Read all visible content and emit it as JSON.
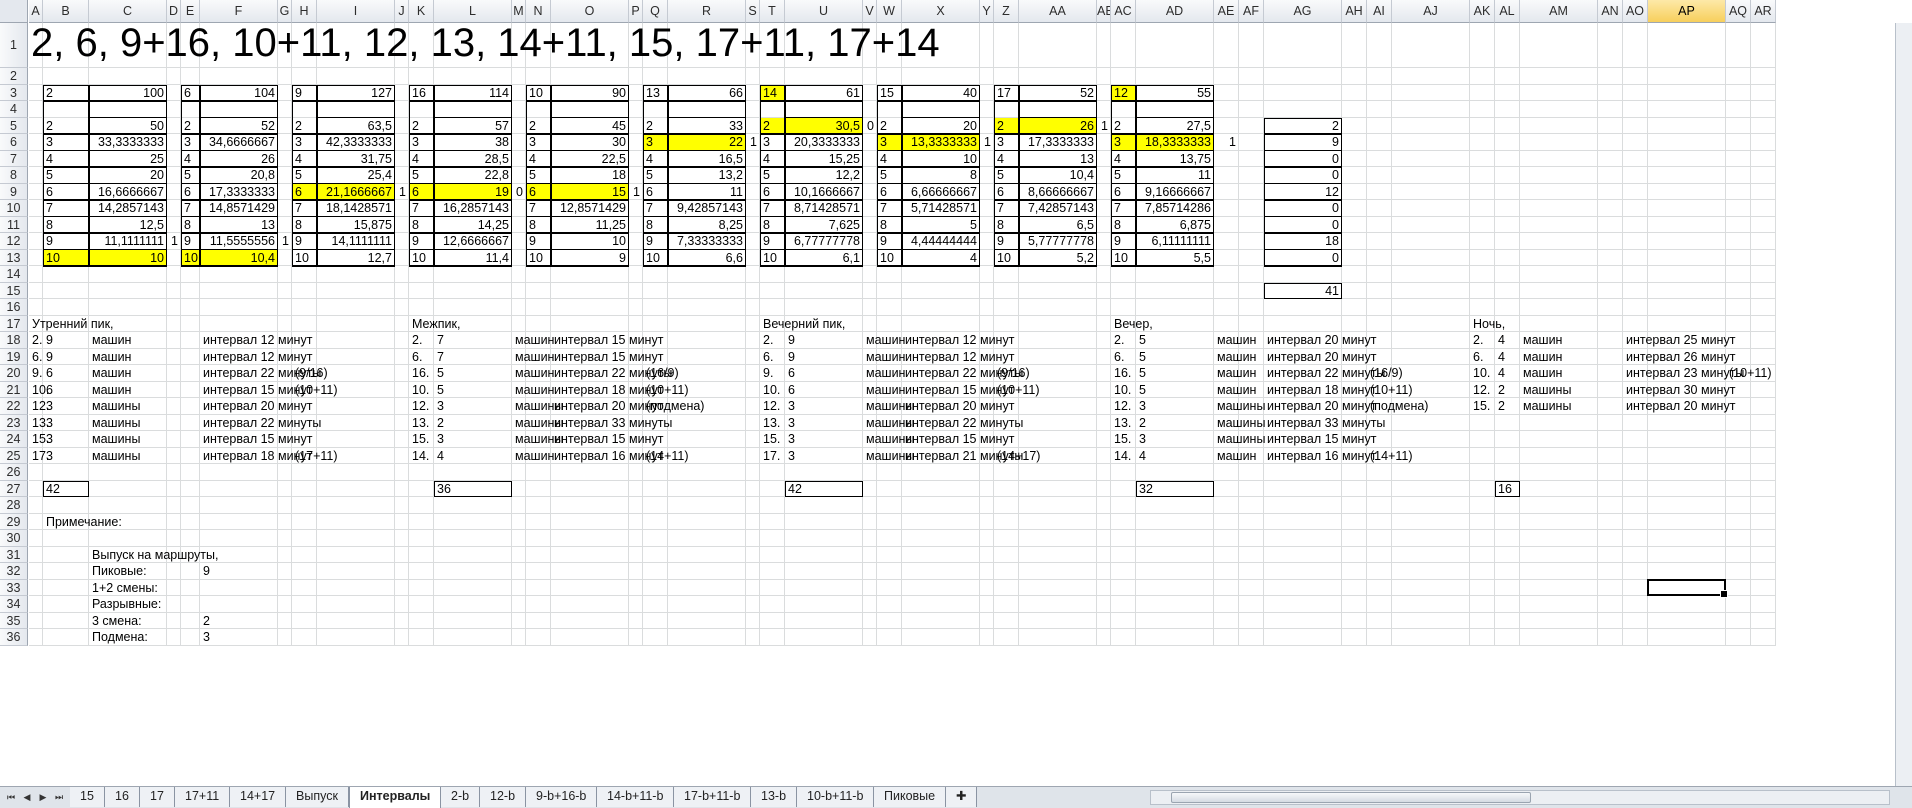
{
  "columns": [
    "A",
    "B",
    "C",
    "D",
    "E",
    "F",
    "G",
    "H",
    "I",
    "J",
    "K",
    "L",
    "M",
    "N",
    "O",
    "P",
    "Q",
    "R",
    "S",
    "T",
    "U",
    "V",
    "W",
    "X",
    "Y",
    "Z",
    "AA",
    "AB",
    "AC",
    "AD",
    "AE",
    "AF",
    "AG",
    "AH",
    "AI",
    "AJ",
    "AK",
    "AL",
    "AM",
    "AN",
    "AO",
    "AP",
    "AQ",
    "AR"
  ],
  "selected_column": "AP",
  "rows": [
    "1",
    "2",
    "3",
    "4",
    "5",
    "6",
    "7",
    "8",
    "9",
    "10",
    "11",
    "12",
    "13",
    "14",
    "15",
    "16",
    "17",
    "18",
    "19",
    "20",
    "21",
    "22",
    "23",
    "24",
    "25",
    "26",
    "27",
    "28",
    "29",
    "30",
    "31",
    "32",
    "33",
    "34",
    "35",
    "36"
  ],
  "title": "2, 6, 9+16, 10+11, 12, 13, 14+11, 15, 17+11, 17+14",
  "blocks": [
    {
      "header": [
        "2",
        "100"
      ],
      "rows": [
        [
          "2",
          "50"
        ],
        [
          "3",
          "33,3333333"
        ],
        [
          "4",
          "25"
        ],
        [
          "5",
          "20"
        ],
        [
          "6",
          "16,6666667"
        ],
        [
          "7",
          "14,2857143"
        ],
        [
          "8",
          "12,5"
        ],
        [
          "9",
          "11,1111111"
        ],
        [
          "10",
          "10"
        ]
      ],
      "side": [
        "",
        "",
        "",
        "",
        "",
        "",
        "",
        "1",
        ""
      ]
    },
    {
      "header": [
        "6",
        "104"
      ],
      "rows": [
        [
          "2",
          "52"
        ],
        [
          "3",
          "34,6666667"
        ],
        [
          "4",
          "26"
        ],
        [
          "5",
          "20,8"
        ],
        [
          "6",
          "17,3333333"
        ],
        [
          "7",
          "14,8571429"
        ],
        [
          "8",
          "13"
        ],
        [
          "9",
          "11,5555556"
        ],
        [
          "10",
          "10,4"
        ]
      ],
      "side": [
        "",
        "",
        "",
        "",
        "",
        "",
        "",
        "1",
        ""
      ]
    },
    {
      "header": [
        "9",
        "127"
      ],
      "rows": [
        [
          "2",
          "63,5"
        ],
        [
          "3",
          "42,3333333"
        ],
        [
          "4",
          "31,75"
        ],
        [
          "5",
          "25,4"
        ],
        [
          "6",
          "21,1666667"
        ],
        [
          "7",
          "18,1428571"
        ],
        [
          "8",
          "15,875"
        ],
        [
          "9",
          "14,1111111"
        ],
        [
          "10",
          "12,7"
        ]
      ],
      "side": [
        "",
        "",
        "",
        "",
        "1",
        "",
        "",
        "",
        ""
      ]
    },
    {
      "header": [
        "16",
        "114"
      ],
      "rows": [
        [
          "2",
          "57"
        ],
        [
          "3",
          "38"
        ],
        [
          "4",
          "28,5"
        ],
        [
          "5",
          "22,8"
        ],
        [
          "6",
          "19"
        ],
        [
          "7",
          "16,2857143"
        ],
        [
          "8",
          "14,25"
        ],
        [
          "9",
          "12,6666667"
        ],
        [
          "10",
          "11,4"
        ]
      ],
      "side": [
        "",
        "",
        "",
        "",
        "0",
        "",
        "",
        "",
        ""
      ]
    },
    {
      "header": [
        "10",
        "90"
      ],
      "rows": [
        [
          "2",
          "45"
        ],
        [
          "3",
          "30"
        ],
        [
          "4",
          "22,5"
        ],
        [
          "5",
          "18"
        ],
        [
          "6",
          "15"
        ],
        [
          "7",
          "12,8571429"
        ],
        [
          "8",
          "11,25"
        ],
        [
          "9",
          "10"
        ],
        [
          "10",
          "9"
        ]
      ],
      "side": [
        "",
        "",
        "",
        "",
        "1",
        "",
        "",
        "",
        ""
      ]
    },
    {
      "header": [
        "13",
        "66"
      ],
      "rows": [
        [
          "2",
          "33"
        ],
        [
          "3",
          "22"
        ],
        [
          "4",
          "16,5"
        ],
        [
          "5",
          "13,2"
        ],
        [
          "6",
          "11"
        ],
        [
          "7",
          "9,42857143"
        ],
        [
          "8",
          "8,25"
        ],
        [
          "9",
          "7,33333333"
        ],
        [
          "10",
          "6,6"
        ]
      ],
      "side": [
        "",
        "1",
        "",
        "",
        "",
        "",
        "",
        "",
        ""
      ]
    },
    {
      "header": [
        "14",
        "61"
      ],
      "rows": [
        [
          "2",
          "30,5"
        ],
        [
          "3",
          "20,3333333"
        ],
        [
          "4",
          "15,25"
        ],
        [
          "5",
          "12,2"
        ],
        [
          "6",
          "10,1666667"
        ],
        [
          "7",
          "8,71428571"
        ],
        [
          "8",
          "7,625"
        ],
        [
          "9",
          "6,77777778"
        ],
        [
          "10",
          "6,1"
        ]
      ],
      "side": [
        "0",
        "",
        "",
        "",
        "",
        "",
        "",
        "",
        ""
      ]
    },
    {
      "header": [
        "15",
        "40"
      ],
      "rows": [
        [
          "2",
          "20"
        ],
        [
          "3",
          "13,3333333"
        ],
        [
          "4",
          "10"
        ],
        [
          "5",
          "8"
        ],
        [
          "6",
          "6,66666667"
        ],
        [
          "7",
          "5,71428571"
        ],
        [
          "8",
          "5"
        ],
        [
          "9",
          "4,44444444"
        ],
        [
          "10",
          "4"
        ]
      ],
      "side": [
        "",
        "1",
        "",
        "",
        "",
        "",
        "",
        "",
        ""
      ]
    },
    {
      "header": [
        "17",
        "52"
      ],
      "rows": [
        [
          "2",
          "26"
        ],
        [
          "3",
          "17,3333333"
        ],
        [
          "4",
          "13"
        ],
        [
          "5",
          "10,4"
        ],
        [
          "6",
          "8,66666667"
        ],
        [
          "7",
          "7,42857143"
        ],
        [
          "8",
          "6,5"
        ],
        [
          "9",
          "5,77777778"
        ],
        [
          "10",
          "5,2"
        ]
      ],
      "side": [
        "1",
        "",
        "",
        "",
        "",
        "",
        "",
        "",
        ""
      ]
    },
    {
      "header": [
        "12",
        "55"
      ],
      "rows": [
        [
          "2",
          "27,5"
        ],
        [
          "3",
          "18,3333333"
        ],
        [
          "4",
          "13,75"
        ],
        [
          "5",
          "11"
        ],
        [
          "6",
          "9,16666667"
        ],
        [
          "7",
          "7,85714286"
        ],
        [
          "8",
          "6,875"
        ],
        [
          "9",
          "6,11111111"
        ],
        [
          "10",
          "5,5"
        ]
      ],
      "side": [
        "",
        "1",
        "",
        "",
        "",
        "",
        "",
        "",
        ""
      ]
    }
  ],
  "ag_values": [
    "2",
    "9",
    "0",
    "0",
    "12",
    "0",
    "0",
    "18",
    "0"
  ],
  "ag_total": "41",
  "periods": [
    {
      "name": "Утренний пик,",
      "total": "42",
      "rows": [
        [
          "2.",
          "9",
          "машин",
          "интервал 12 минут",
          ""
        ],
        [
          "6.",
          "9",
          "машин",
          "интервал 12 минут",
          ""
        ],
        [
          "9.",
          "6",
          "машин",
          "интервал 22 минуты",
          "(9/16)"
        ],
        [
          "10.",
          "6",
          "машин",
          "интервал 15 минут",
          "(10+11)"
        ],
        [
          "12.",
          "3",
          "машины",
          "интервал 20 минут",
          ""
        ],
        [
          "13.",
          "3",
          "машины",
          "интервал 22 минуты",
          ""
        ],
        [
          "15.",
          "3",
          "машины",
          "интервал 15 минут",
          ""
        ],
        [
          "17.",
          "3",
          "машины",
          "интервал 18 минут",
          "(17+11)"
        ]
      ]
    },
    {
      "name": "Межпик,",
      "total": "36",
      "rows": [
        [
          "2.",
          "7",
          "машин",
          "интервал 15 минут",
          ""
        ],
        [
          "6.",
          "7",
          "машин",
          "интервал 15 минут",
          ""
        ],
        [
          "16.",
          "5",
          "машин",
          "интервал 22 минуты",
          "(16/9)"
        ],
        [
          "10.",
          "5",
          "машин",
          "интервал 18 минут",
          "(10+11)"
        ],
        [
          "12.",
          "3",
          "машины",
          "интервал 20 минут",
          "(подмена)"
        ],
        [
          "13.",
          "2",
          "машины",
          "интервал 33 минуты",
          ""
        ],
        [
          "15.",
          "3",
          "машины",
          "интервал 15 минут",
          ""
        ],
        [
          "14.",
          "4",
          "машин",
          "интервал 16 минут",
          "(14+11)"
        ]
      ]
    },
    {
      "name": "Вечерний пик,",
      "total": "42",
      "rows": [
        [
          "2.",
          "9",
          "машин",
          "интервал 12 минут",
          ""
        ],
        [
          "6.",
          "9",
          "машин",
          "интервал 12 минут",
          ""
        ],
        [
          "9.",
          "6",
          "машин",
          "интервал 22 минуты",
          "(9/16)"
        ],
        [
          "10.",
          "6",
          "машин",
          "интервал 15 минут",
          "(10+11)"
        ],
        [
          "12.",
          "3",
          "машины",
          "интервал 20 минут",
          ""
        ],
        [
          "13.",
          "3",
          "машины",
          "интервал 22 минуты",
          ""
        ],
        [
          "15.",
          "3",
          "машины",
          "интервал 15 минут",
          ""
        ],
        [
          "17.",
          "3",
          "машины",
          "интервал 21 минуты",
          "(14+17)"
        ]
      ]
    },
    {
      "name": "Вечер,",
      "total": "32",
      "rows": [
        [
          "2.",
          "5",
          "машин",
          "интервал 20 минут",
          ""
        ],
        [
          "6.",
          "5",
          "машин",
          "интервал 20 минут",
          ""
        ],
        [
          "16.",
          "5",
          "машин",
          "интервал 22 минуты",
          "(16/9)"
        ],
        [
          "10.",
          "5",
          "машин",
          "интервал 18 минут",
          "(10+11)"
        ],
        [
          "12.",
          "3",
          "машины",
          "интервал 20 минут",
          "(подмена)"
        ],
        [
          "13.",
          "2",
          "машины",
          "интервал 33 минуты",
          ""
        ],
        [
          "15.",
          "3",
          "машины",
          "интервал 15 минут",
          ""
        ],
        [
          "14.",
          "4",
          "машин",
          "интервал 16 минут",
          "(14+11)"
        ]
      ]
    },
    {
      "name": "Ночь,",
      "total": "16",
      "rows": [
        [
          "2.",
          "4",
          "машин",
          "интервал 25 минут",
          ""
        ],
        [
          "6.",
          "4",
          "машин",
          "интервал 26 минут",
          ""
        ],
        [
          "10.",
          "4",
          "машин",
          "интервал 23 минуты",
          "(10+11)"
        ],
        [
          "12.",
          "2",
          "машины",
          "интервал 30 минут",
          ""
        ],
        [
          "15.",
          "2",
          "машины",
          "интервал 20 минут",
          ""
        ]
      ]
    }
  ],
  "note": "Примечание:",
  "release": {
    "title": "Выпуск на маршруты,",
    "items": [
      [
        "Пиковые:",
        "9"
      ],
      [
        "1+2 смены:",
        ""
      ],
      [
        "Разрывные:",
        ""
      ],
      [
        "3 смена:",
        "2"
      ],
      [
        "Подмена:",
        "3"
      ]
    ]
  },
  "sheet_tabs": [
    "15",
    "16",
    "17",
    "17+11",
    "14+17",
    "Выпуск",
    "Интервалы",
    "2-b",
    "12-b",
    "9-b+16-b",
    "14-b+11-b",
    "17-b+11-b",
    "13-b",
    "10-b+11-b",
    "Пиковые"
  ],
  "active_tab": "Интервалы",
  "colors": {
    "highlight": "#ffff00",
    "grid": "#dadcdd",
    "header": "#e4e8ee",
    "selected_header": "#f7cf5c"
  }
}
